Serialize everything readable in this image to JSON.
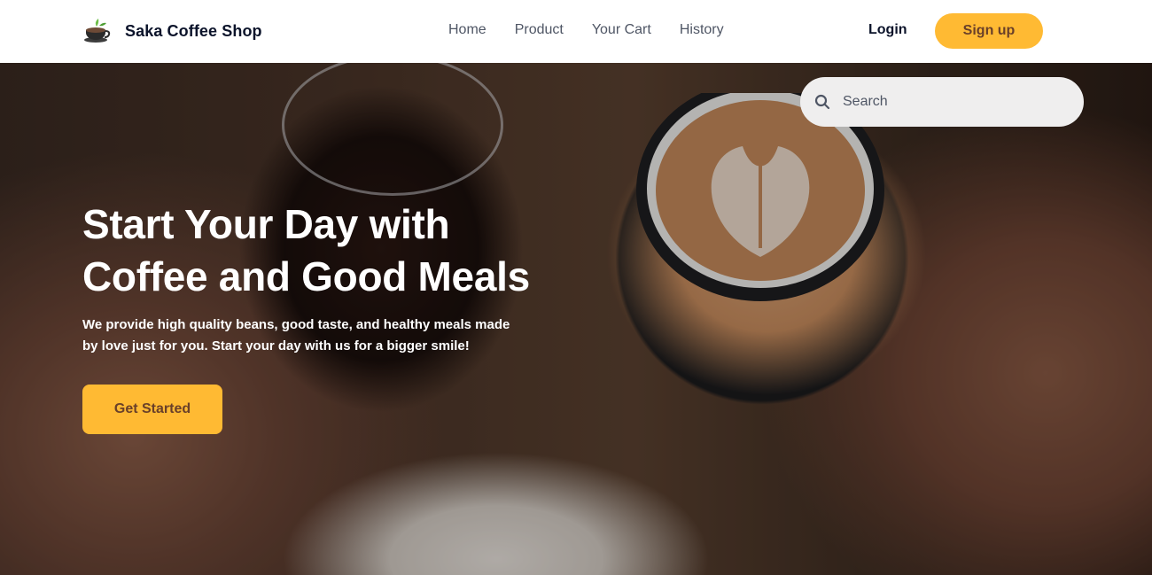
{
  "header": {
    "brand_name": "Saka Coffee Shop",
    "nav": [
      "Home",
      "Product",
      "Your Cart",
      "History"
    ],
    "login_label": "Login",
    "signup_label": "Sign up"
  },
  "hero": {
    "search_placeholder": "Search",
    "title_line1": "Start Your Day with",
    "title_line2": "Coffee and Good Meals",
    "subtitle_line1": "We provide high quality beans, good taste, and healthy meals made",
    "subtitle_line2": "by love just for you. Start your day with us for a bigger smile!",
    "cta_label": "Get Started"
  },
  "colors": {
    "accent": "#ffba33",
    "accent_text": "#6a4029",
    "dark_text": "#0b132a",
    "nav_text": "#4f5665"
  },
  "icons": {
    "logo": "coffee-cup-logo-icon",
    "search": "search-icon"
  }
}
